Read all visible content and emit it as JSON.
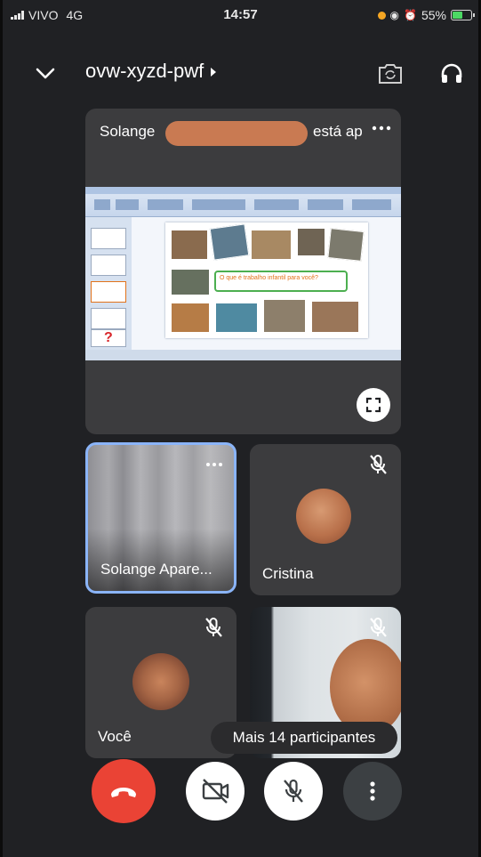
{
  "status_bar": {
    "carrier": "VIVO",
    "network": "4G",
    "time": "14:57",
    "battery_percent_text": "55%",
    "battery_level": 0.55
  },
  "header": {
    "meeting_code": "ovw-xyzd-pwf",
    "back_icon": "chevron-down-icon",
    "camera_switch_icon": "camera-flip-icon",
    "audio_icon": "headphones-icon"
  },
  "presentation": {
    "presenter_first": "Solange",
    "presenter_tail": "está ap",
    "slide_text": "O que é trabalho infantil para você?",
    "fullscreen_icon": "fullscreen-icon"
  },
  "participants": [
    {
      "name": "Solange Apare...",
      "muted": false,
      "active": true
    },
    {
      "name": "Cristina",
      "muted": true,
      "active": false
    },
    {
      "name": "Você",
      "muted": true,
      "active": false
    },
    {
      "name": "",
      "muted": true,
      "active": false
    }
  ],
  "more_participants_label": "Mais 14 participantes",
  "controls": {
    "hangup_icon": "phone-hangup-icon",
    "camera_icon": "camera-off-icon",
    "mic_icon": "mic-off-icon",
    "more_icon": "more-vertical-icon"
  },
  "colors": {
    "background": "#202124",
    "tile": "#3c3c3e",
    "active_border": "#8ab4f8",
    "hangup": "#ea4335",
    "redaction": "#c97a52"
  }
}
